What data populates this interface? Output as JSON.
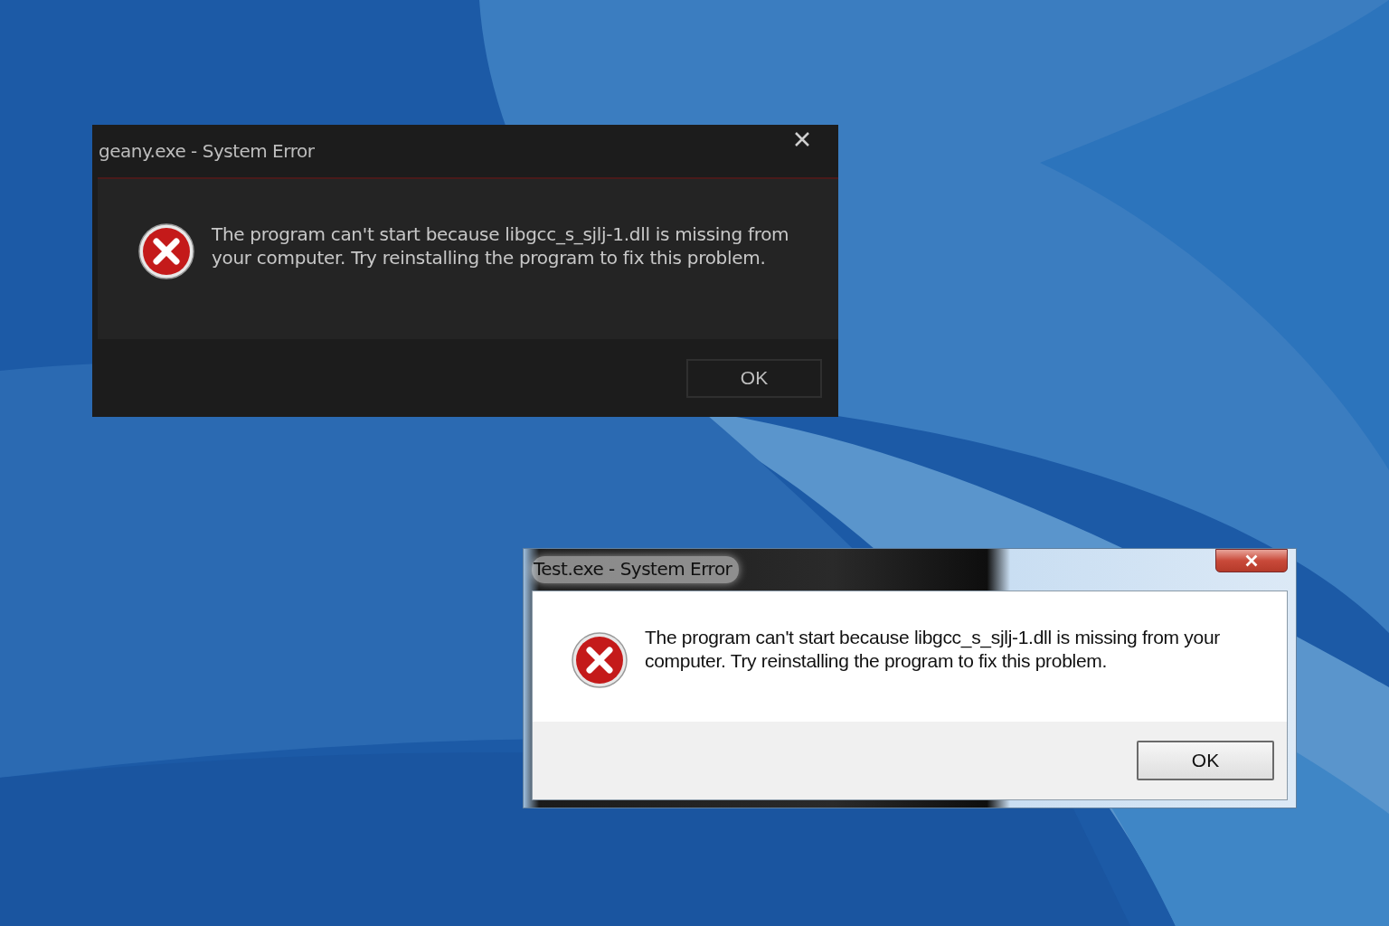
{
  "windows": [
    {
      "kind": "dark",
      "title": "geany.exe - System Error",
      "message": "The program can't start because libgcc_s_sjlj-1.dll is missing from your computer. Try reinstalling the program to fix this problem.",
      "button": "OK"
    },
    {
      "kind": "classic",
      "title": "Test.exe - System Error",
      "message": "The program can't start because libgcc_s_sjlj-1.dll is missing from your computer. Try reinstalling the program to fix this problem.",
      "button": "OK"
    }
  ]
}
